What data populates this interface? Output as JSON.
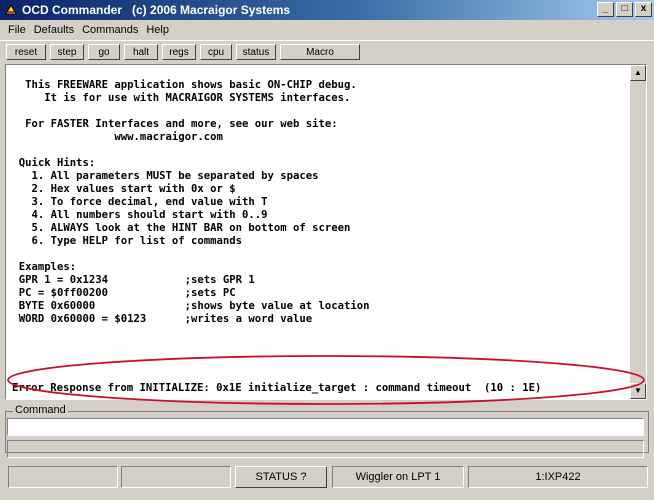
{
  "window": {
    "title": "OCD Commander   (c) 2006 Macraigor Systems",
    "controls": [
      "_",
      "□",
      "x"
    ]
  },
  "menu": [
    "File",
    "Defaults",
    "Commands",
    "Help"
  ],
  "toolbar": {
    "buttons": [
      "reset",
      "step",
      "go",
      "halt",
      "regs",
      "cpu",
      "status",
      "Macro"
    ]
  },
  "console": {
    "lines": [
      "   This FREEWARE application shows basic ON-CHIP debug.",
      "      It is for use with MACRAIGOR SYSTEMS interfaces.",
      "",
      "   For FASTER Interfaces and more, see our web site:",
      "                 www.macraigor.com",
      "",
      "  Quick Hints:",
      "    1. All parameters MUST be separated by spaces",
      "    2. Hex values start with 0x or $",
      "    3. To force decimal, end value with T",
      "    4. All numbers should start with 0..9",
      "    5. ALWAYS look at the HINT BAR on bottom of screen",
      "    6. Type HELP for list of commands",
      "",
      "  Examples:",
      "  GPR 1 = 0x1234            ;sets GPR 1",
      "  PC = $0ff00200            ;sets PC",
      "  BYTE 0x60000              ;shows byte value at location",
      "  WORD 0x60000 = $0123      ;writes a word value"
    ],
    "error_line": "Error Response from INITIALIZE: 0x1E initialize_target : command timeout  (10 : 1E)",
    "highlight_color": "#c8102e"
  },
  "command": {
    "label": "Command",
    "value": "",
    "hint": ""
  },
  "status": {
    "panel_1": "",
    "panel_2": "",
    "status_button": "STATUS ?",
    "interface": "Wiggler on LPT 1",
    "target": "1:IXP422"
  }
}
